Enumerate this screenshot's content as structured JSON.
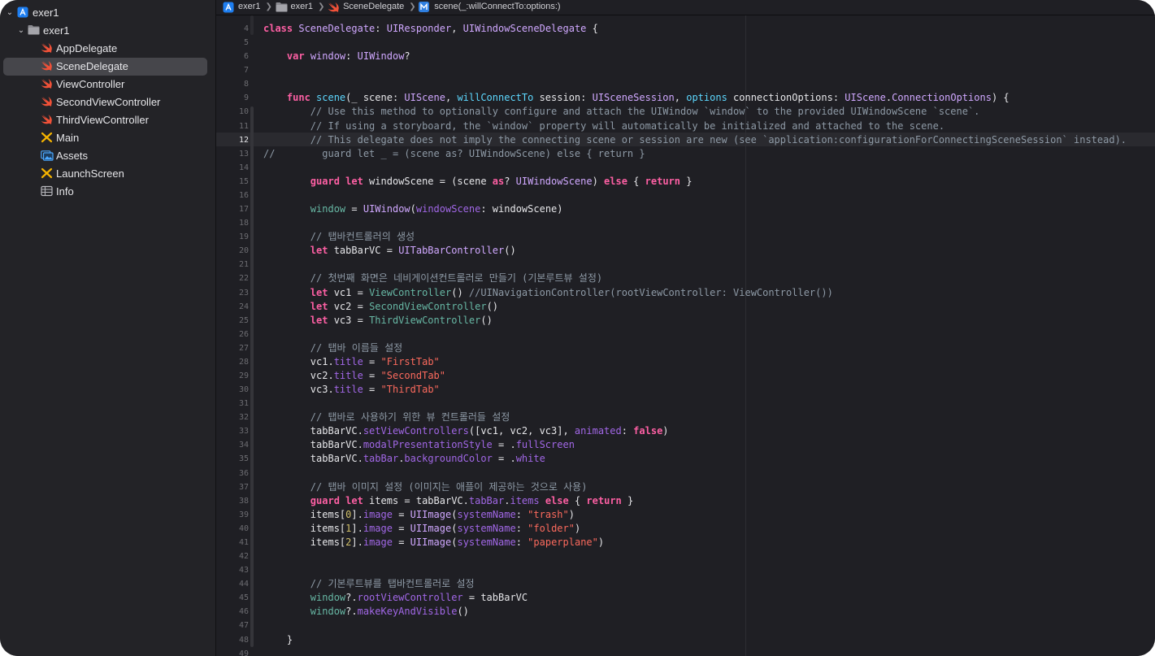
{
  "navigator": {
    "items": [
      {
        "label": "exer1",
        "icon": "xcode-project-icon",
        "level": 0,
        "disclosure": "expanded"
      },
      {
        "label": "exer1",
        "icon": "folder-icon",
        "level": 1,
        "disclosure": "expanded"
      },
      {
        "label": "AppDelegate",
        "icon": "swift-file-icon",
        "level": 2
      },
      {
        "label": "SceneDelegate",
        "icon": "swift-file-icon",
        "level": 2,
        "selected": true
      },
      {
        "label": "ViewController",
        "icon": "swift-file-icon",
        "level": 2
      },
      {
        "label": "SecondViewController",
        "icon": "swift-file-icon",
        "level": 2
      },
      {
        "label": "ThirdViewController",
        "icon": "swift-file-icon",
        "level": 2
      },
      {
        "label": "Main",
        "icon": "storyboard-icon",
        "level": 2
      },
      {
        "label": "Assets",
        "icon": "asset-catalog-icon",
        "level": 2
      },
      {
        "label": "LaunchScreen",
        "icon": "storyboard-icon",
        "level": 2
      },
      {
        "label": "Info",
        "icon": "plist-table-icon",
        "level": 2
      }
    ]
  },
  "jumpbar": {
    "crumbs": [
      {
        "label": "exer1",
        "icon": "xcode-project-icon"
      },
      {
        "label": "exer1",
        "icon": "folder-icon"
      },
      {
        "label": "SceneDelegate",
        "icon": "swift-file-icon"
      },
      {
        "label": "scene(_:willConnectTo:options:)",
        "icon": "method-icon"
      }
    ]
  },
  "editor": {
    "current_line": 12,
    "lines": [
      {
        "n": 4,
        "segs": [
          [
            "kw",
            "class "
          ],
          [
            "tp",
            "SceneDelegate"
          ],
          [
            "pl",
            ": "
          ],
          [
            "tp",
            "UIResponder"
          ],
          [
            "pl",
            ", "
          ],
          [
            "tp",
            "UIWindowSceneDelegate"
          ],
          [
            "pl",
            " {"
          ]
        ]
      },
      {
        "n": 5,
        "segs": []
      },
      {
        "n": 6,
        "segs": [
          [
            "pl",
            "    "
          ],
          [
            "kw",
            "var "
          ],
          [
            "tp",
            "window"
          ],
          [
            "pl",
            ": "
          ],
          [
            "tp",
            "UIWindow"
          ],
          [
            "pl",
            "?"
          ]
        ]
      },
      {
        "n": 7,
        "segs": []
      },
      {
        "n": 8,
        "segs": []
      },
      {
        "n": 9,
        "segs": [
          [
            "pl",
            "    "
          ],
          [
            "kw",
            "func "
          ],
          [
            "ty",
            "scene"
          ],
          [
            "pl",
            "(_ scene: "
          ],
          [
            "tp",
            "UIScene"
          ],
          [
            "pl",
            ", "
          ],
          [
            "ty",
            "willConnectTo"
          ],
          [
            "pl",
            " session: "
          ],
          [
            "tp",
            "UISceneSession"
          ],
          [
            "pl",
            ", "
          ],
          [
            "ty",
            "options"
          ],
          [
            "pl",
            " connectionOptions: "
          ],
          [
            "tp",
            "UIScene"
          ],
          [
            "pl",
            "."
          ],
          [
            "tp",
            "ConnectionOptions"
          ],
          [
            "pl",
            ") {"
          ]
        ]
      },
      {
        "n": 10,
        "segs": [
          [
            "cm",
            "        // Use this method to optionally configure and attach the UIWindow `window` to the provided UIWindowScene `scene`."
          ]
        ]
      },
      {
        "n": 11,
        "segs": [
          [
            "cm",
            "        // If using a storyboard, the `window` property will automatically be initialized and attached to the scene."
          ]
        ]
      },
      {
        "n": 12,
        "segs": [
          [
            "cm",
            "        // This delegate does not imply the connecting scene or session are new (see `application:configurationForConnectingSceneSession` instead)."
          ]
        ]
      },
      {
        "n": 13,
        "segs": [
          [
            "cm",
            "//        guard let _ = (scene as? UIWindowScene) else { return }"
          ]
        ]
      },
      {
        "n": 14,
        "segs": []
      },
      {
        "n": 15,
        "segs": [
          [
            "pl",
            "        "
          ],
          [
            "kw",
            "guard let "
          ],
          [
            "pl",
            "windowScene = (scene "
          ],
          [
            "kw",
            "as"
          ],
          [
            "pl",
            "? "
          ],
          [
            "tp",
            "UIWindowScene"
          ],
          [
            "pl",
            ") "
          ],
          [
            "kw",
            "else"
          ],
          [
            "pl",
            " { "
          ],
          [
            "kw",
            "return"
          ],
          [
            "pl",
            " }"
          ]
        ]
      },
      {
        "n": 16,
        "segs": []
      },
      {
        "n": 17,
        "segs": [
          [
            "pl",
            "        "
          ],
          [
            "fn",
            "window"
          ],
          [
            "pl",
            " = "
          ],
          [
            "tp",
            "UIWindow"
          ],
          [
            "pl",
            "("
          ],
          [
            "pm",
            "windowScene"
          ],
          [
            "pl",
            ": windowScene)"
          ]
        ]
      },
      {
        "n": 18,
        "segs": []
      },
      {
        "n": 19,
        "segs": [
          [
            "cm",
            "        // 탭바컨트롤러의 생성"
          ]
        ]
      },
      {
        "n": 20,
        "segs": [
          [
            "pl",
            "        "
          ],
          [
            "kw",
            "let "
          ],
          [
            "pl",
            "tabBarVC = "
          ],
          [
            "tp",
            "UITabBarController"
          ],
          [
            "pl",
            "()"
          ]
        ]
      },
      {
        "n": 21,
        "segs": []
      },
      {
        "n": 22,
        "segs": [
          [
            "cm",
            "        // 첫번째 화면은 네비게이션컨트롤러로 만들기 (기본루트뷰 설정)"
          ]
        ]
      },
      {
        "n": 23,
        "segs": [
          [
            "pl",
            "        "
          ],
          [
            "kw",
            "let "
          ],
          [
            "pl",
            "vc1 = "
          ],
          [
            "fn",
            "ViewController"
          ],
          [
            "pl",
            "() "
          ],
          [
            "cm",
            "//UINavigationController(rootViewController: ViewController())"
          ]
        ]
      },
      {
        "n": 24,
        "segs": [
          [
            "pl",
            "        "
          ],
          [
            "kw",
            "let "
          ],
          [
            "pl",
            "vc2 = "
          ],
          [
            "fn",
            "SecondViewController"
          ],
          [
            "pl",
            "()"
          ]
        ]
      },
      {
        "n": 25,
        "segs": [
          [
            "pl",
            "        "
          ],
          [
            "kw",
            "let "
          ],
          [
            "pl",
            "vc3 = "
          ],
          [
            "fn",
            "ThirdViewController"
          ],
          [
            "pl",
            "()"
          ]
        ]
      },
      {
        "n": 26,
        "segs": []
      },
      {
        "n": 27,
        "segs": [
          [
            "cm",
            "        // 탭바 이름들 설정"
          ]
        ]
      },
      {
        "n": 28,
        "segs": [
          [
            "pl",
            "        vc1."
          ],
          [
            "pm",
            "title"
          ],
          [
            "pl",
            " = "
          ],
          [
            "st",
            "\"FirstTab\""
          ]
        ]
      },
      {
        "n": 29,
        "segs": [
          [
            "pl",
            "        vc2."
          ],
          [
            "pm",
            "title"
          ],
          [
            "pl",
            " = "
          ],
          [
            "st",
            "\"SecondTab\""
          ]
        ]
      },
      {
        "n": 30,
        "segs": [
          [
            "pl",
            "        vc3."
          ],
          [
            "pm",
            "title"
          ],
          [
            "pl",
            " = "
          ],
          [
            "st",
            "\"ThirdTab\""
          ]
        ]
      },
      {
        "n": 31,
        "segs": []
      },
      {
        "n": 32,
        "segs": [
          [
            "cm",
            "        // 탭바로 사용하기 위한 뷰 컨트롤러들 설정"
          ]
        ]
      },
      {
        "n": 33,
        "segs": [
          [
            "pl",
            "        tabBarVC."
          ],
          [
            "pm",
            "setViewControllers"
          ],
          [
            "pl",
            "([vc1, vc2, vc3], "
          ],
          [
            "pm",
            "animated"
          ],
          [
            "pl",
            ": "
          ],
          [
            "kw",
            "false"
          ],
          [
            "pl",
            ")"
          ]
        ]
      },
      {
        "n": 34,
        "segs": [
          [
            "pl",
            "        tabBarVC."
          ],
          [
            "pm",
            "modalPresentationStyle"
          ],
          [
            "pl",
            " = ."
          ],
          [
            "pm",
            "fullScreen"
          ]
        ]
      },
      {
        "n": 35,
        "segs": [
          [
            "pl",
            "        tabBarVC."
          ],
          [
            "pm",
            "tabBar"
          ],
          [
            "pl",
            "."
          ],
          [
            "pm",
            "backgroundColor"
          ],
          [
            "pl",
            " = ."
          ],
          [
            "pm",
            "white"
          ]
        ]
      },
      {
        "n": 36,
        "segs": []
      },
      {
        "n": 37,
        "segs": [
          [
            "cm",
            "        // 탭바 이미지 설정 (이미지는 애플이 제공하는 것으로 사용)"
          ]
        ]
      },
      {
        "n": 38,
        "segs": [
          [
            "pl",
            "        "
          ],
          [
            "kw",
            "guard let "
          ],
          [
            "pl",
            "items = tabBarVC."
          ],
          [
            "pm",
            "tabBar"
          ],
          [
            "pl",
            "."
          ],
          [
            "pm",
            "items"
          ],
          [
            "pl",
            " "
          ],
          [
            "kw",
            "else"
          ],
          [
            "pl",
            " { "
          ],
          [
            "kw",
            "return"
          ],
          [
            "pl",
            " }"
          ]
        ]
      },
      {
        "n": 39,
        "segs": [
          [
            "pl",
            "        items["
          ],
          [
            "nm",
            "0"
          ],
          [
            "pl",
            "]."
          ],
          [
            "pm",
            "image"
          ],
          [
            "pl",
            " = "
          ],
          [
            "tp",
            "UIImage"
          ],
          [
            "pl",
            "("
          ],
          [
            "pm",
            "systemName"
          ],
          [
            "pl",
            ": "
          ],
          [
            "st",
            "\"trash\""
          ],
          [
            "pl",
            ")"
          ]
        ]
      },
      {
        "n": 40,
        "segs": [
          [
            "pl",
            "        items["
          ],
          [
            "nm",
            "1"
          ],
          [
            "pl",
            "]."
          ],
          [
            "pm",
            "image"
          ],
          [
            "pl",
            " = "
          ],
          [
            "tp",
            "UIImage"
          ],
          [
            "pl",
            "("
          ],
          [
            "pm",
            "systemName"
          ],
          [
            "pl",
            ": "
          ],
          [
            "st",
            "\"folder\""
          ],
          [
            "pl",
            ")"
          ]
        ]
      },
      {
        "n": 41,
        "segs": [
          [
            "pl",
            "        items["
          ],
          [
            "nm",
            "2"
          ],
          [
            "pl",
            "]."
          ],
          [
            "pm",
            "image"
          ],
          [
            "pl",
            " = "
          ],
          [
            "tp",
            "UIImage"
          ],
          [
            "pl",
            "("
          ],
          [
            "pm",
            "systemName"
          ],
          [
            "pl",
            ": "
          ],
          [
            "st",
            "\"paperplane\""
          ],
          [
            "pl",
            ")"
          ]
        ]
      },
      {
        "n": 42,
        "segs": []
      },
      {
        "n": 43,
        "segs": []
      },
      {
        "n": 44,
        "segs": [
          [
            "cm",
            "        // 기본루트뷰를 탭바컨트롤러로 설정"
          ]
        ]
      },
      {
        "n": 45,
        "segs": [
          [
            "pl",
            "        "
          ],
          [
            "fn",
            "window"
          ],
          [
            "pl",
            "?."
          ],
          [
            "pm",
            "rootViewController"
          ],
          [
            "pl",
            " = tabBarVC"
          ]
        ]
      },
      {
        "n": 46,
        "segs": [
          [
            "pl",
            "        "
          ],
          [
            "fn",
            "window"
          ],
          [
            "pl",
            "?."
          ],
          [
            "pm",
            "makeKeyAndVisible"
          ],
          [
            "pl",
            "()"
          ]
        ]
      },
      {
        "n": 47,
        "segs": []
      },
      {
        "n": 48,
        "segs": [
          [
            "pl",
            "    }"
          ]
        ]
      },
      {
        "n": 49,
        "segs": []
      }
    ]
  },
  "colors": {
    "background": "#1f1f24",
    "sidebar": "#232327",
    "selection": "#46464b",
    "keyword": "#fc5fa3",
    "type": "#d0a8ff",
    "declaration": "#5dd8ff",
    "function": "#67b7a4",
    "property": "#a167e6",
    "string": "#fc6a5d",
    "comment": "#8e9aa6",
    "number": "#d0bf69"
  }
}
